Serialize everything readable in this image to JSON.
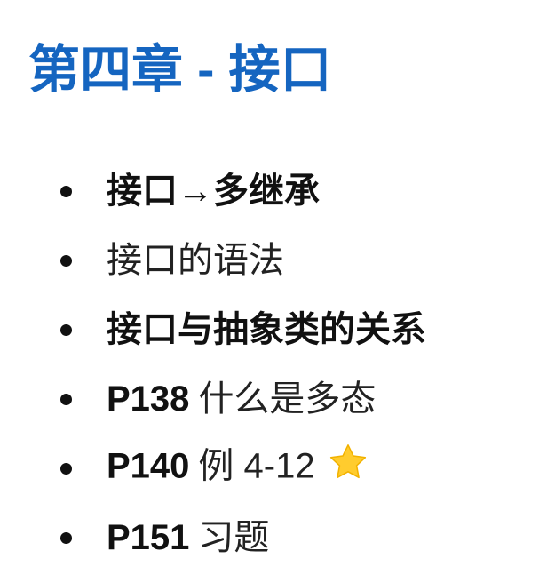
{
  "title": "第四章 - 接口",
  "items": [
    {
      "bold": "接口→多继承",
      "rest": ""
    },
    {
      "bold": "",
      "rest": "接口的语法"
    },
    {
      "bold": "接口与抽象类的关系",
      "rest": ""
    },
    {
      "bold": "P138",
      "rest": "什么是多态"
    },
    {
      "bold": "P140",
      "rest": "例 4-12",
      "icon": "star-icon"
    },
    {
      "bold": "P151",
      "rest": "习题"
    }
  ],
  "colors": {
    "title": "#1565c0",
    "star": "#ffcc2e"
  }
}
